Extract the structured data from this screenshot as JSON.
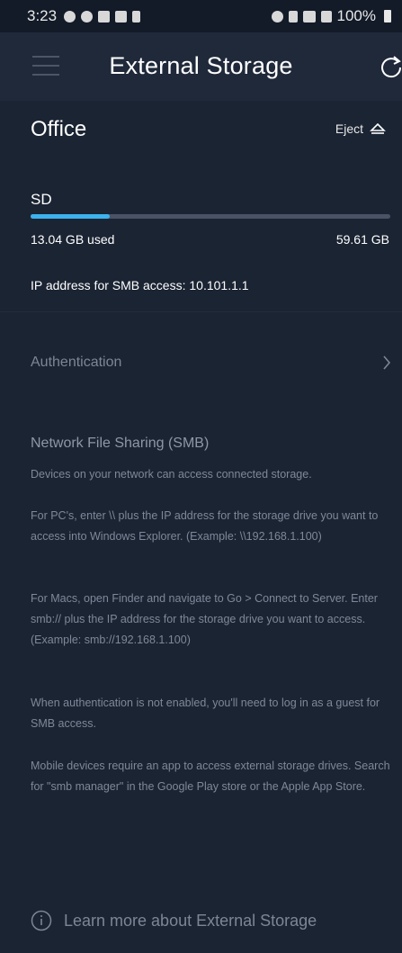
{
  "status_bar": {
    "time": "3:23",
    "battery": "100%",
    "left_icons": [
      "sync-icon",
      "wifi-icon",
      "gallery-icon",
      "chat-icon",
      "lock-icon"
    ],
    "right_icons": [
      "alarm-icon",
      "mute-icon",
      "4g-icon",
      "signal-icon",
      "battery-icon"
    ]
  },
  "header": {
    "title": "External Storage",
    "menu_icon": "hamburger-icon",
    "refresh_icon": "refresh-icon"
  },
  "drive": {
    "name": "Office",
    "eject_label": "Eject",
    "eject_icon": "eject-icon",
    "type_label": "SD",
    "used": "13.04 GB used",
    "total": "59.61 GB",
    "used_fraction": 0.219,
    "ip_text": "IP address for SMB access: 10.101.1.1"
  },
  "authentication": {
    "label": "Authentication",
    "chevron_icon": "chevron-right-icon"
  },
  "smb": {
    "title": "Network File Sharing (SMB)",
    "paragraphs": [
      "Devices on your network can access connected storage.",
      "For PC's, enter \\\\ plus the IP address for the storage drive you want to access into Windows Explorer. (Example: \\\\192.168.1.100)",
      "For Macs, open Finder and navigate to Go > Connect to Server. Enter smb:// plus the IP address for the storage drive you want to access. (Example: smb://192.168.1.100)",
      "When authentication is not enabled, you'll need to log in as a guest for SMB access.",
      "Mobile devices require an app to access external storage drives. Search for \"smb manager\" in the Google Play store or the Apple App Store."
    ]
  },
  "footer": {
    "learn_more": "Learn more about External Storage",
    "info_icon": "info-icon"
  },
  "colors": {
    "background": "#1b2433",
    "progress_fill": "#3cb2ee",
    "progress_track": "#4a5365"
  }
}
